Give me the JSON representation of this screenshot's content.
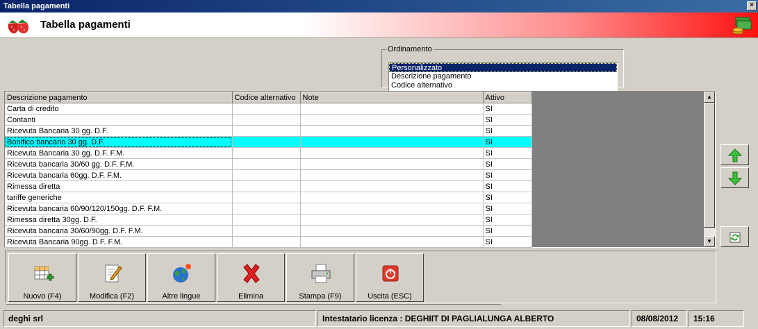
{
  "window": {
    "title": "Tabella pagamenti",
    "close_glyph": "×"
  },
  "header": {
    "title": "Tabella pagamenti",
    "logo_icon": "strawberry-icon",
    "right_icon": "money-icon"
  },
  "ordering": {
    "legend": "Ordinamento",
    "options": [
      "Personalizzato",
      "Descrizione pagamento",
      "Codice alternativo"
    ],
    "selected": "Personalizzato"
  },
  "grid": {
    "columns": [
      "Descrizione pagamento",
      "Codice alternativo",
      "Note",
      "Attivo"
    ],
    "rows": [
      [
        "Carta di credito",
        "",
        "",
        "SI"
      ],
      [
        "Contanti",
        "",
        "",
        "SI"
      ],
      [
        "Ricevuta Bancaria 30 gg. D.F.",
        "",
        "",
        "SI"
      ],
      [
        "Bonifico bancario 30 gg. D.F.",
        "",
        "",
        "SI"
      ],
      [
        "Ricevuta Bancaria 30 gg. D.F. F.M.",
        "",
        "",
        "SI"
      ],
      [
        "Ricevuta bancaria 30/60 gg. D.F. F.M.",
        "",
        "",
        "SI"
      ],
      [
        "Ricevuta bancaria 60gg. D.F. F.M.",
        "",
        "",
        "SI"
      ],
      [
        "Rimessa diretta",
        "",
        "",
        "SI"
      ],
      [
        "tariffe generiche",
        "",
        "",
        "SI"
      ],
      [
        "Ricevuta bancaria 60/90/120/150gg. D.F. F.M.",
        "",
        "",
        "SI"
      ],
      [
        "Rimessa diretta 30gg. D.F.",
        "",
        "",
        "SI"
      ],
      [
        "Ricevuta bancaria 30/60/90gg. D.F. F.M.",
        "",
        "",
        "SI"
      ],
      [
        "Ricevuta Bancaria 90gg. D.F. F.M.",
        "",
        "",
        "SI"
      ]
    ],
    "selected_row": 3,
    "selected_color": "#00ffff"
  },
  "side_buttons": [
    "arrow-up-icon",
    "arrow-down-icon",
    "refresh-icon"
  ],
  "toolbar": {
    "buttons": [
      {
        "label": "Nuovo (F4)",
        "icon": "new-record-icon"
      },
      {
        "label": "Modifica (F2)",
        "icon": "edit-icon"
      },
      {
        "label": "Altre lingue",
        "icon": "globe-icon"
      },
      {
        "label": "Elimina",
        "icon": "delete-icon"
      },
      {
        "label": "Stampa (F9)",
        "icon": "printer-icon"
      },
      {
        "label": "Uscita (ESC)",
        "icon": "power-icon"
      }
    ]
  },
  "status": {
    "company": "deghi srl",
    "license": "Intestatario licenza : DEGHIIT DI PAGLIALUNGA ALBERTO",
    "date": "08/08/2012",
    "time": "15:16"
  },
  "colors": {
    "title_bar": "#0a246a",
    "header_red": "#ff1010",
    "panel": "#d4d0c8"
  }
}
